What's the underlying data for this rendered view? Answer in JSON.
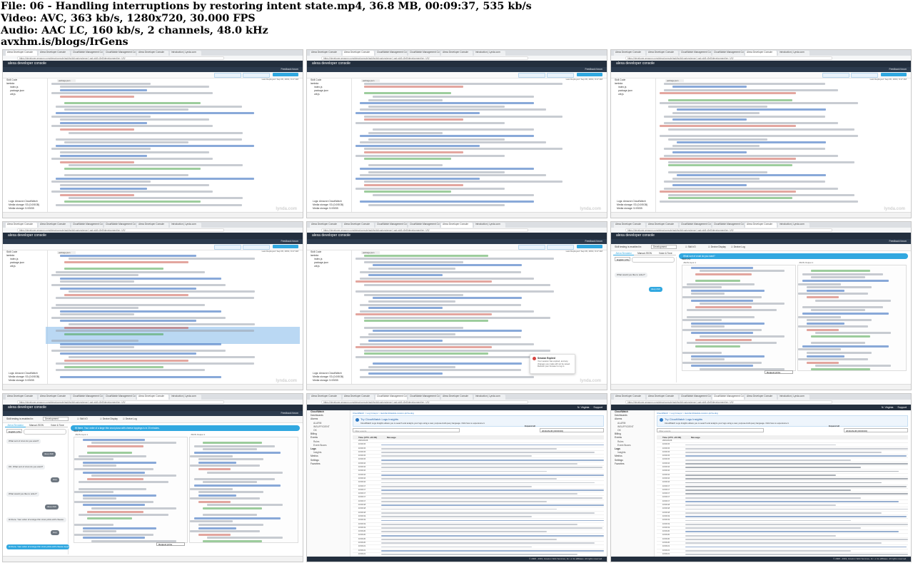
{
  "header": {
    "file": "File: 06 - Handling interruptions by restoring intent state.mp4, 36.8 MB, 00:09:37, 535 kb/s",
    "video": "Video: AVC, 363 kb/s, 1280x720, 30.000 FPS",
    "audio": "Audio: AAC LC, 160 kb/s, 2 channels, 48.0 kHz",
    "link": "avxhm.is/blogs/IrGens"
  },
  "alexa": {
    "console_title": "alexa developer console",
    "nav": [
      "< Your Skills",
      "Pizza Dog",
      "Build",
      "Code",
      "Test",
      "Distribution",
      "Certification",
      "Analytics"
    ],
    "feedback": "Feedback forum",
    "buttons": [
      "Save",
      "Deploy",
      "Promote to live"
    ],
    "last_deployed": "Last Deployed: Sep 06, 2019, 9:17 AM",
    "tree": [
      "Skill Code",
      "lambda",
      "index.js",
      "package.json",
      "util.js"
    ],
    "code_tab": "package.json",
    "log_links": [
      "Logs: Amazon CloudWatch",
      "Media storage: S3 (0.0/5GB)",
      "Media storage: 5.0/5GB"
    ],
    "test_bar": {
      "label": "Skill testing is enabled in:",
      "stage": "Development",
      "checks": [
        "Skill I/O",
        "Device Display",
        "Device Log"
      ]
    },
    "sim_tabs": [
      "Alexa Simulator",
      "Manual JSON",
      "Voice & Tone"
    ],
    "lang": "English (US)",
    "chat": {
      "what_cost": "What sort of crust do you want?",
      "what_order": "What would you like to order?",
      "deep_dish": "deep dish",
      "alexa_prompt": "OK. What sort of crust do you want?",
      "stop": "stop",
      "reprompt": "Hi there. Your order of a large thin crust pizza with cheese.",
      "anon": "Hi there. Your order of a large thin crust pizza with cheese toppings is in 20 minutes."
    },
    "skill_io": "Skill I/O",
    "json_in": "JSON Input 1",
    "json_out": "JSON Output 1",
    "select": "Request pizza",
    "toast": {
      "title": "Session Expired",
      "body": "Your session has expired, and any changes you made will not be saved. Refresh your browser to log in."
    }
  },
  "aws": {
    "logo": "aws",
    "services": "Services",
    "resource_groups": "Resource Groups",
    "region": "N. Virginia",
    "support": "Support",
    "sidebar": [
      "CloudWatch",
      "Dashboards",
      "Alarms",
      "ALARM",
      "INSUFFICIENT",
      "OK",
      "Billing",
      "Events",
      "Rules",
      "Event Buses",
      "Logs",
      "Insights",
      "Metrics",
      "Settings",
      "Favorites"
    ],
    "crumb": "CloudWatch > Log Groups > /aws/lambda/ask-custom-pizza-dog",
    "info_title": "Try CloudWatch Logs Insights",
    "info_body": "CloudWatch Logs Insights allows you to search and analyze your logs using a new, purpose-built query language. Click here to experience it.",
    "filter": "Filter events",
    "date": "2019-09-06 (00:00:00)",
    "expand": "Expand all",
    "col_time": "Time (UTC +00:00)",
    "col_msg": "Message",
    "date_row": "2019-09-06",
    "times": [
      "16:09:15",
      "16:09:15",
      "16:09:15",
      "16:09:15",
      "16:09:15",
      "16:09:16",
      "16:09:16",
      "16:09:16",
      "16:09:16",
      "16:09:16",
      "16:09:16",
      "16:09:17",
      "16:09:17",
      "16:09:17",
      "16:09:17",
      "16:09:17",
      "16:09:18",
      "16:09:18",
      "16:09:18",
      "16:09:19",
      "16:09:19",
      "16:09:19",
      "16:09:19",
      "16:09:20",
      "16:09:20",
      "16:09:20",
      "16:09:20",
      "16:09:21",
      "16:09:21",
      "16:09:21",
      "16:09:21",
      "16:09:21"
    ],
    "footer": [
      "Feedback",
      "English (US)"
    ],
    "footer_right": "© 2008 - 2019, Amazon Web Services, Inc. or its affiliates. All rights reserved."
  },
  "browser": {
    "tabs": [
      "Alexa Developer Console",
      "Alexa Developer Console",
      "CloudWatch Management Co",
      "CloudWatch Management Co",
      "Alexa Developer Console",
      "Introduction | Lynda.com"
    ],
    "url": "https://developer.amazon.com/alexa/console/ask/build/custom/amzn1.ask.skill.c3e8/development/en_US/"
  },
  "watermark": "lynda.com"
}
